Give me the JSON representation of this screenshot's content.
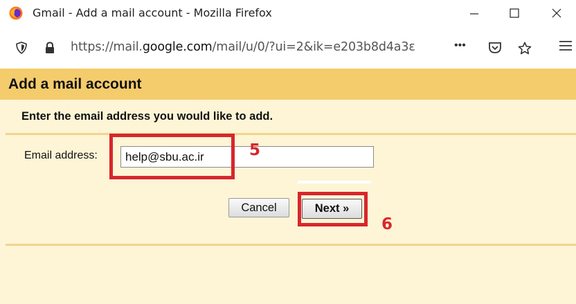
{
  "window": {
    "title": "Gmail - Add a mail account - Mozilla Firefox"
  },
  "browser": {
    "url_prefix": "https://mail.",
    "url_domain": "google.com",
    "url_suffix": "/mail/u/0/?ui=2&ik=e203b8d4a3ε",
    "overflow_dots": "•••"
  },
  "page": {
    "header_title": "Add a mail account",
    "subheading": "Enter the email address you would like to add.",
    "email_label": "Email address:",
    "email_value": "help@sbu.ac.ir",
    "cancel_label": "Cancel",
    "next_label": "Next »"
  },
  "annotations": {
    "step_5": "5",
    "step_6": "6"
  },
  "colors": {
    "header_bg": "#f5cc6c",
    "panel_bg": "#fdf5d6",
    "annotation": "#d8262c"
  }
}
